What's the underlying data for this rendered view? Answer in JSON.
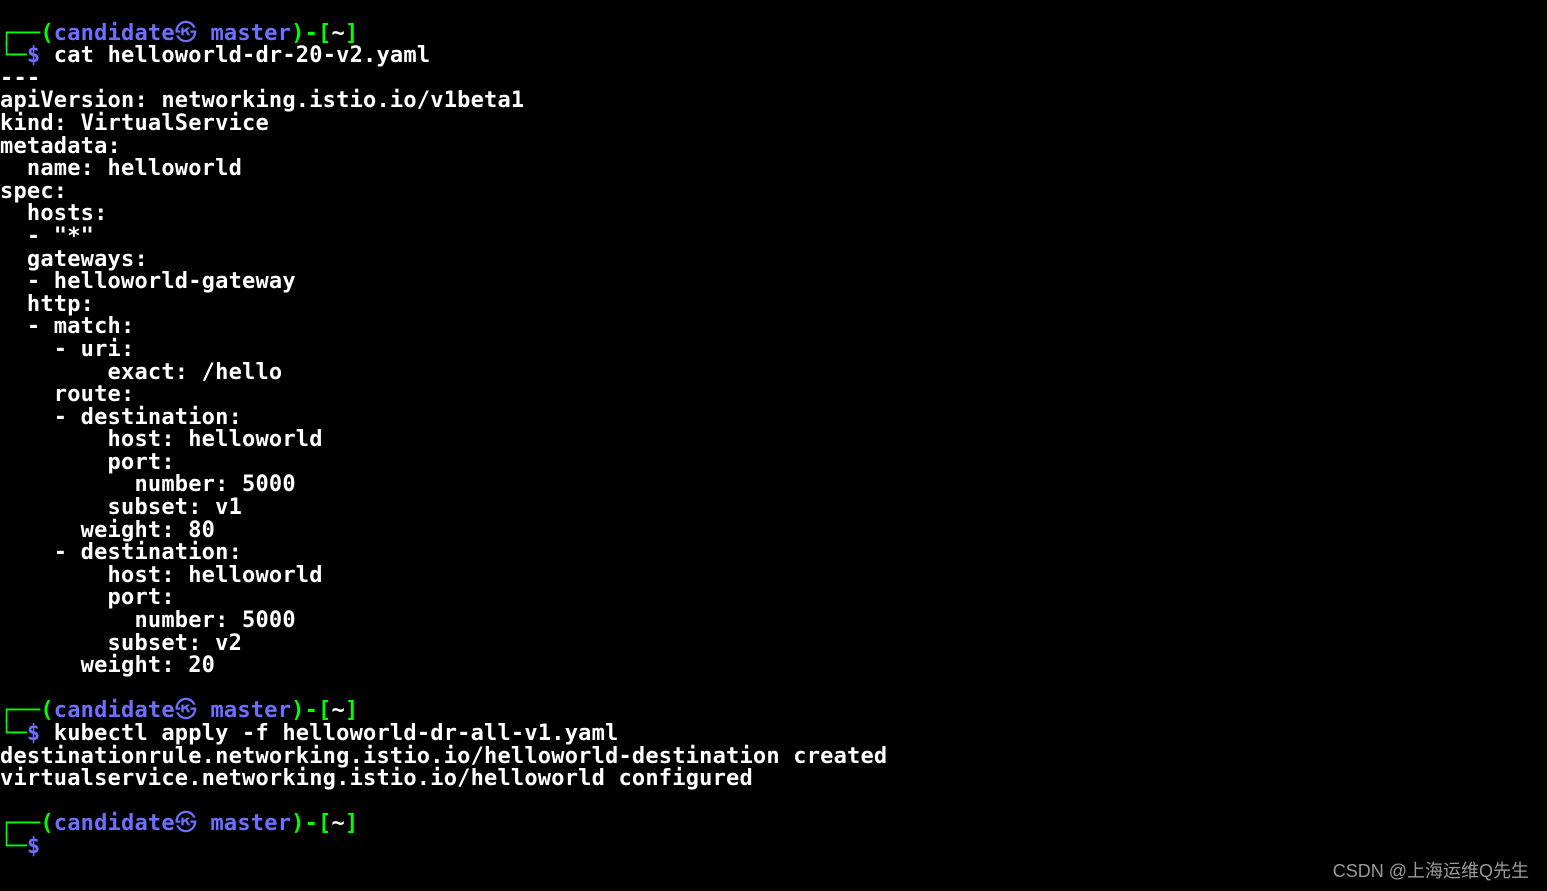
{
  "prompt": {
    "corner_tl": "┌──",
    "corner_bl": "└─",
    "open": "(",
    "close": ")",
    "user": "candidate",
    "skull": "㉿",
    "host": "master",
    "sep": "-",
    "path_open": "[",
    "path": "~",
    "path_close": "]",
    "dollar": "$"
  },
  "cmd1": "cat helloworld-dr-20-v2.yaml",
  "yaml": [
    "---",
    "apiVersion: networking.istio.io/v1beta1",
    "kind: VirtualService",
    "metadata:",
    "  name: helloworld",
    "spec:",
    "  hosts:",
    "  - \"*\"",
    "  gateways:",
    "  - helloworld-gateway",
    "  http:",
    "  - match:",
    "    - uri:",
    "        exact: /hello",
    "    route:",
    "    - destination:",
    "        host: helloworld",
    "        port:",
    "          number: 5000",
    "        subset: v1",
    "      weight: 80",
    "    - destination:",
    "        host: helloworld",
    "        port:",
    "          number: 5000",
    "        subset: v2",
    "      weight: 20"
  ],
  "blank": "",
  "cmd2": "kubectl apply -f helloworld-dr-all-v1.yaml",
  "out2": [
    "destinationrule.networking.istio.io/helloworld-destination created",
    "virtualservice.networking.istio.io/helloworld configured"
  ],
  "watermark": "CSDN @上海运维Q先生"
}
